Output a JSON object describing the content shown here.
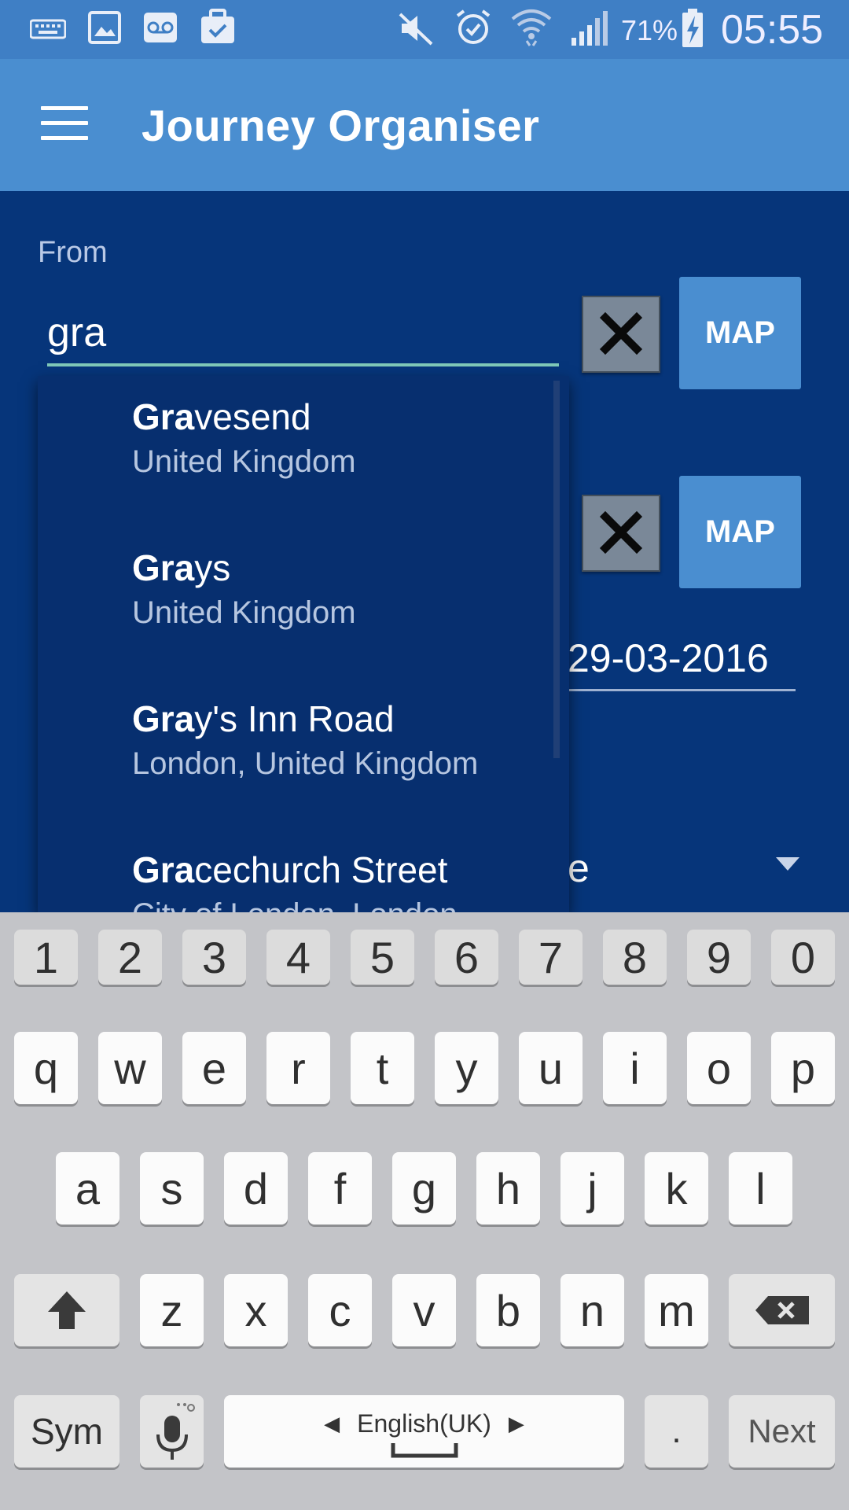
{
  "status_bar": {
    "battery": "71%",
    "time": "05:55",
    "icons": [
      "keyboard-icon",
      "image-icon",
      "voicemail-icon",
      "briefcase-icon",
      "mute-icon",
      "alarm-icon",
      "wifi-icon",
      "signal-icon",
      "battery-charging-icon"
    ]
  },
  "app_bar": {
    "title": "Journey Organiser",
    "menu_icon": "hamburger-menu-icon"
  },
  "form": {
    "from_label": "From",
    "from_value": "gra",
    "map_label": "MAP",
    "date_value": "29-03-2016",
    "partial_value": "e"
  },
  "suggestions": [
    {
      "match": "Gra",
      "rest": "vesend",
      "sub": "United Kingdom"
    },
    {
      "match": "Gra",
      "rest": "ys",
      "sub": "United Kingdom"
    },
    {
      "match": "Gra",
      "rest": "y's Inn Road",
      "sub": "London, United Kingdom"
    },
    {
      "match": "Gra",
      "rest": "cechurch Street",
      "sub": "City of London, London"
    }
  ],
  "keyboard": {
    "row_numbers": [
      "1",
      "2",
      "3",
      "4",
      "5",
      "6",
      "7",
      "8",
      "9",
      "0"
    ],
    "row1": [
      "q",
      "w",
      "e",
      "r",
      "t",
      "y",
      "u",
      "i",
      "o",
      "p"
    ],
    "row2": [
      "a",
      "s",
      "d",
      "f",
      "g",
      "h",
      "j",
      "k",
      "l"
    ],
    "row3": [
      "z",
      "x",
      "c",
      "v",
      "b",
      "n",
      "m"
    ],
    "sym_label": "Sym",
    "language_label": "English(UK)",
    "period": ".",
    "next_label": "Next"
  },
  "colors": {
    "status_bar": "#3f7fc5",
    "app_bar": "#4a8ed0",
    "background": "#06357a",
    "dropdown": "#072f6f",
    "accent_underline": "#7fc8b8",
    "keyboard_bg": "#c3c4c8"
  }
}
